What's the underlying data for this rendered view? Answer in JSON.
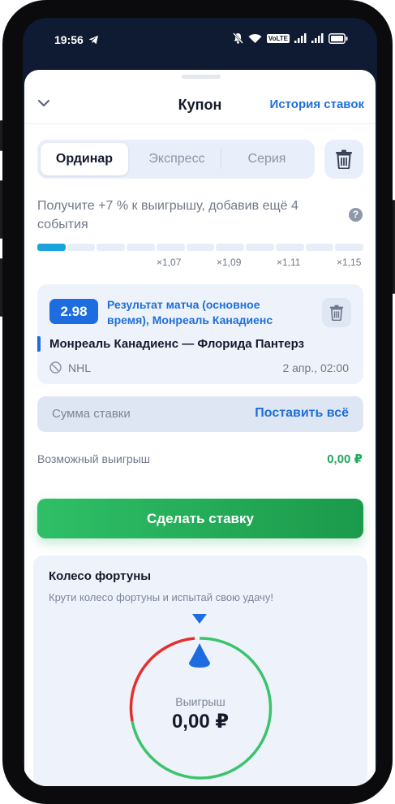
{
  "status": {
    "time": "19:56",
    "icons": [
      "telegram-icon",
      "mute-icon",
      "wifi-icon",
      "volte-icon",
      "signal-icon",
      "signal-icon",
      "battery-icon"
    ],
    "volte_label": "VoLTE"
  },
  "header": {
    "title": "Купон",
    "history_link": "История ставок"
  },
  "tabs": [
    {
      "label": "Ординар",
      "active": true
    },
    {
      "label": "Экспресс",
      "active": false
    },
    {
      "label": "Серия",
      "active": false
    }
  ],
  "promo": {
    "text": "Получите +7 % к выигрышу, добавив ещё 4 события",
    "help_icon": "?",
    "progress_filled_segments": 1,
    "progress_total_segments": 11,
    "multipliers": [
      "×1,07",
      "×1,09",
      "×1,11",
      "×1,15"
    ]
  },
  "bet": {
    "odds": "2.98",
    "market": "Результат матча (основное время), Монреаль Канадиенс",
    "event": "Монреаль Канадиенс — Флорида Пантерз",
    "league": "NHL",
    "datetime": "2 апр., 02:00"
  },
  "stake": {
    "placeholder": "Сумма ставки",
    "all_in_label": "Поставить всё"
  },
  "winnings": {
    "label": "Возможный выигрыш",
    "value": "0,00 ₽"
  },
  "place_bet_label": "Сделать ставку",
  "wheel": {
    "title": "Колесо фортуны",
    "subtitle": "Крути колесо фортуны и испытай свою удачу!",
    "win_label": "Выигрыш",
    "win_amount": "0,00 ₽"
  },
  "colors": {
    "accent": "#1e6fd9",
    "odds_badge": "#1d6ce0",
    "progress_fill": "#1ba4dc",
    "success": "#20a85a",
    "wheel_red": "#e52f2f",
    "wheel_green": "#3cc36c"
  }
}
